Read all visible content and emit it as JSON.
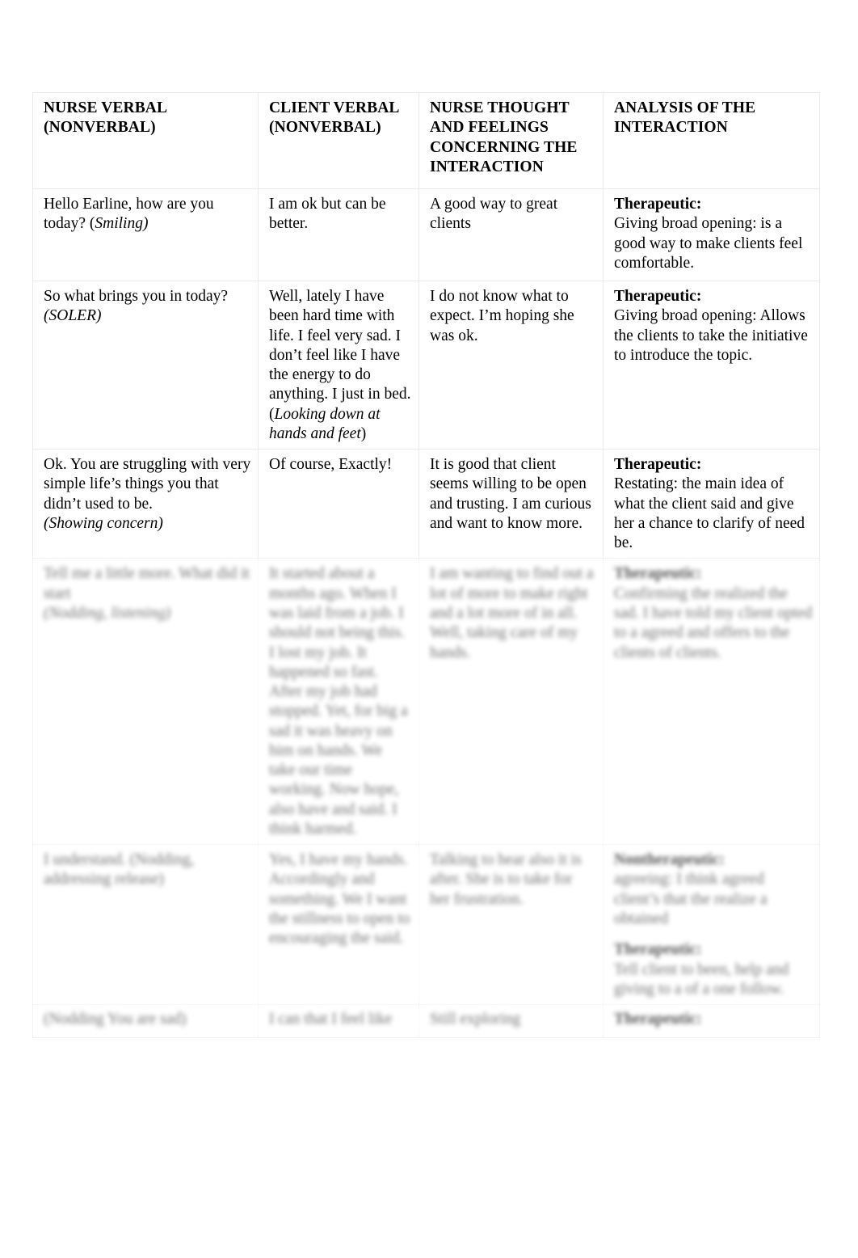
{
  "document": {
    "type": "process-recording-table",
    "columns": [
      "NURSE VERBAL (NONVERBAL)",
      "CLIENT VERBAL (NONVERBAL)",
      "NURSE THOUGHT AND FEELINGS CONCERNING THE INTERACTION",
      "ANALYSIS OF THE INTERACTION"
    ]
  },
  "headers": {
    "col1_line1": "NURSE VERBAL",
    "col1_line2": "(NONVERBAL)",
    "col2_line1": "CLIENT VERBAL",
    "col2_line2": "(NONVERBAL)",
    "col3_line1": "NURSE THOUGHT",
    "col3_line2": "AND FEELINGS",
    "col3_line3": "CONCERNING THE",
    "col3_line4": "INTERACTION",
    "col4_line1": "ANALYSIS OF THE",
    "col4_line2": "INTERACTION"
  },
  "rows": [
    {
      "id": "row-1",
      "redacted": false,
      "nurse_verbal_text": "Hello Earline, how are you today? (",
      "nurse_verbal_nonverbal": "Smiling)",
      "client_verbal": "I am ok but can be better.",
      "nurse_thoughts": "A good way to great clients",
      "analysis_label": "Therapeutic:",
      "analysis_text": "Giving broad opening: is a good way to make clients feel comfortable."
    },
    {
      "id": "row-2",
      "redacted": false,
      "nurse_verbal_text": "So what brings you in today?",
      "nurse_verbal_nonverbal": "(SOLER)",
      "client_verbal_text": "Well, lately I have been hard time with life. I feel very sad. I don’t feel like I have the energy to do anything. I just in bed. (",
      "client_verbal_nonverbal": "Looking down at hands and feet",
      "client_verbal_tail": ")",
      "nurse_thoughts": "I do not know what to expect. I’m hoping she was ok.",
      "analysis_label": "Therapeutic:",
      "analysis_text": "Giving broad opening: Allows the clients to take the initiative to introduce the topic."
    },
    {
      "id": "row-3",
      "redacted": false,
      "nurse_verbal_text": "Ok. You are struggling with very simple life’s things you that didn’t used to be.",
      "nurse_verbal_nonverbal": "(Showing concern)",
      "client_verbal": "Of course, Exactly!",
      "nurse_thoughts": "It is good that client seems willing to be open and trusting. I am curious and want to know more.",
      "analysis_label": "Therapeutic:",
      "analysis_text": "Restating: the main idea of what the client said and give her a chance to clarify of need be."
    },
    {
      "id": "row-4",
      "redacted": true,
      "nurse_verbal_text": "Tell me a little more. What did it start",
      "nurse_verbal_nonverbal": "(Nodding, listening)",
      "client_verbal_text": "It started about a months ago. When I was laid from a job. I should not being this. I lost my job. It happened so fast. After my job had stopped. Yet, for big a sad it was heavy on him on hands. We take our time working. Now hope, also have and said. I think harmed.",
      "nurse_thoughts": "I am wanting to find out a lot of more to make right and a lot more of in all. Well, taking care of my hands.",
      "analysis_label": "Therapeutic:",
      "analysis_text": "Confirming the realized the sad. I have told my client opted to a agreed and offers to the clients of clients."
    },
    {
      "id": "row-5",
      "redacted": true,
      "nurse_verbal_text": "I understand. (Nodding, addressing release)",
      "client_verbal_text": "Yes, I have my hands. Accordingly and something. We I want the stillness to open to encouraging the said.",
      "nurse_thoughts": "Talking to hear also it is after. She is to take for her frustration.",
      "analysis_label_1": "Nontherapeutic:",
      "analysis_text_1": "agreeing: I think agreed client’s that the realize a obtained",
      "analysis_label_2": "Therapeutic:",
      "analysis_text_2": "Tell client to been, help and giving to a of a one follow."
    },
    {
      "id": "row-6",
      "redacted": true,
      "nurse_verbal_text": "(Nodding You are sad)",
      "client_verbal_text": "I can that I feel like",
      "nurse_thoughts": "Still exploring",
      "analysis_label": "Therapeutic:"
    }
  ]
}
